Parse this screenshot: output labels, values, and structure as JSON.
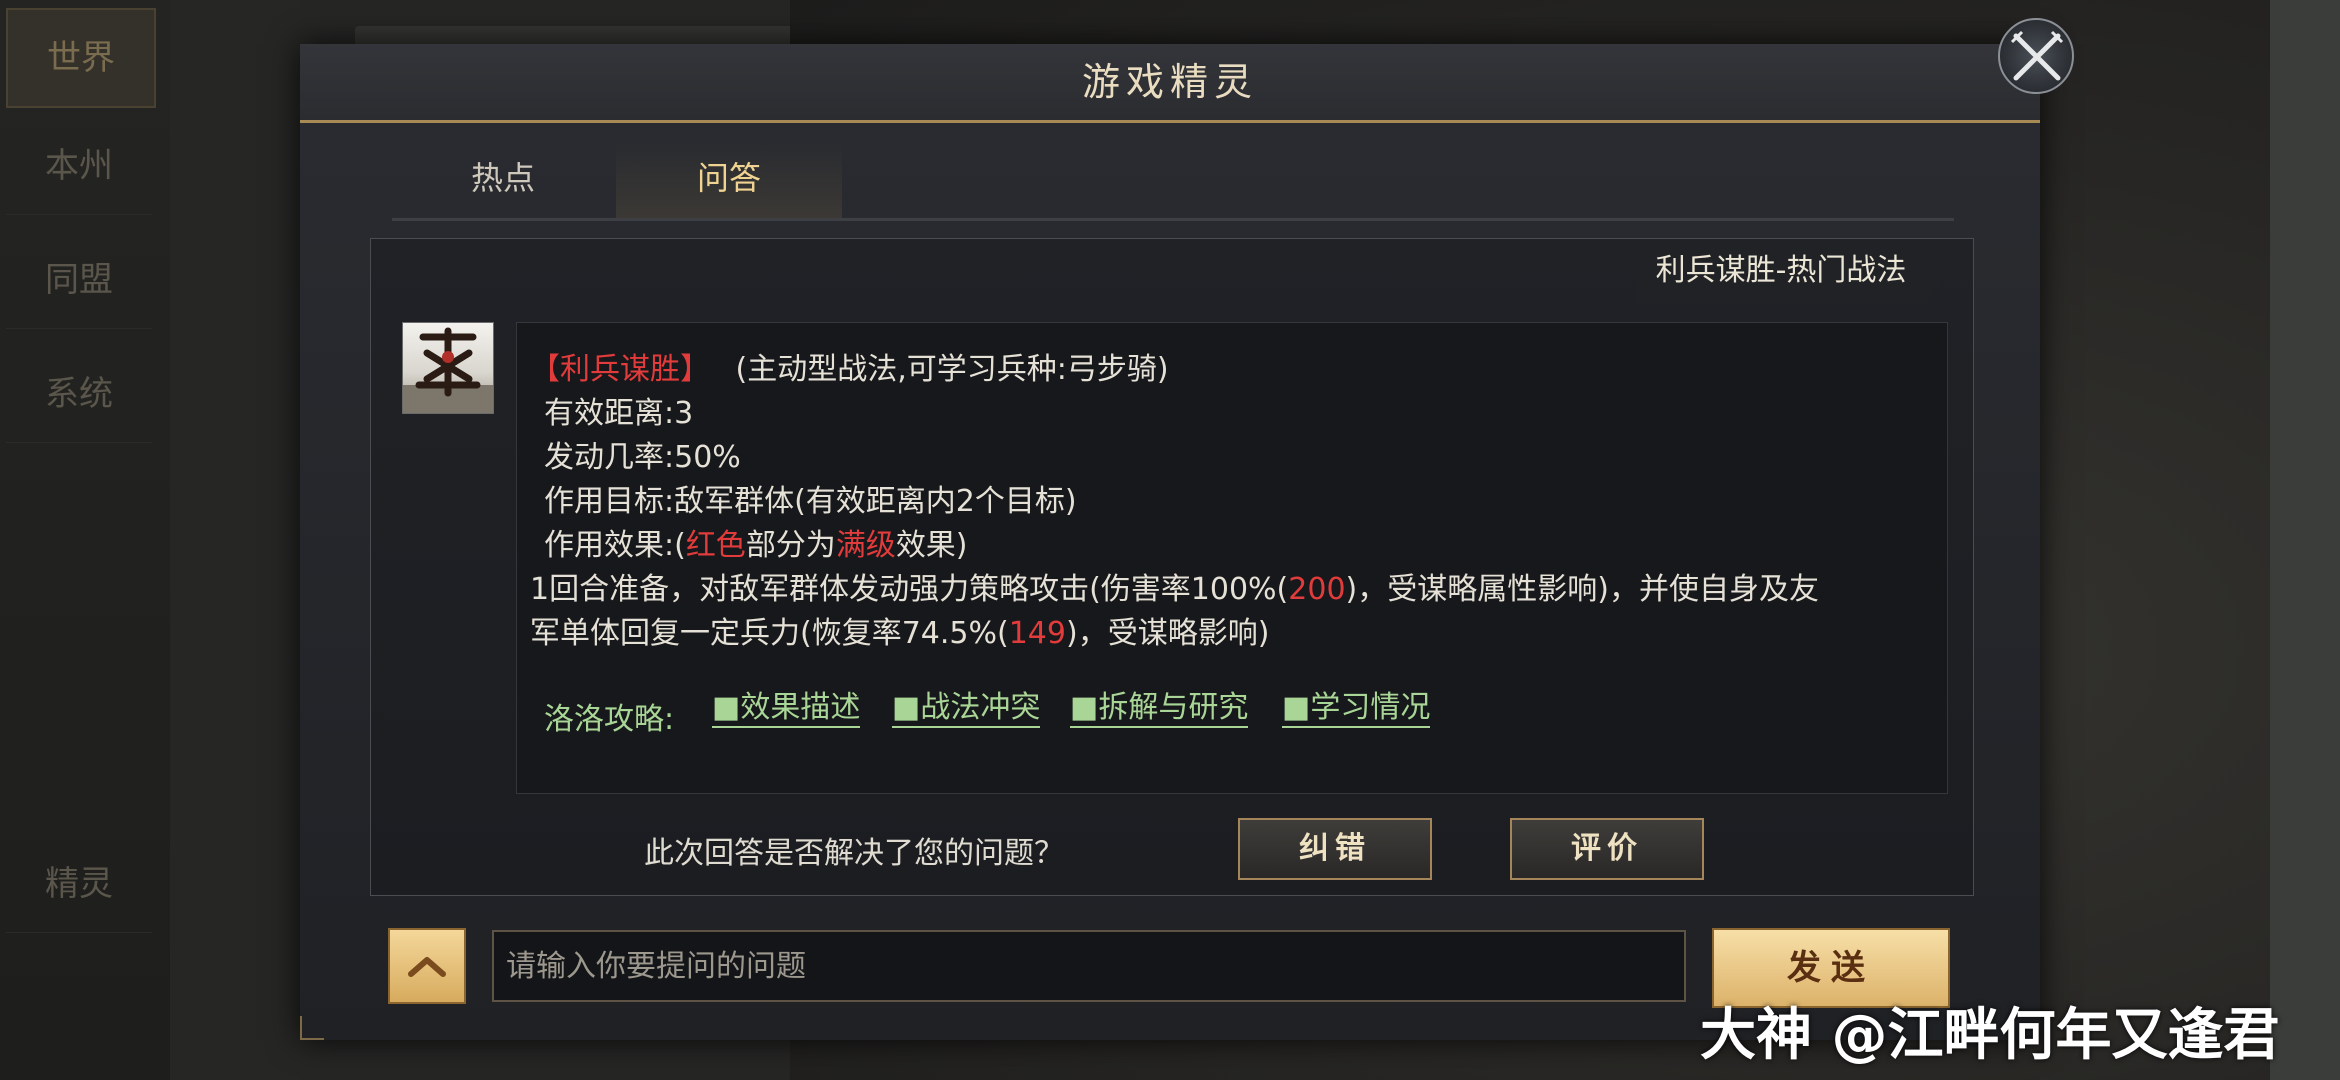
{
  "background": {
    "side_tabs": [
      "世界",
      "本州",
      "同盟",
      "系统"
    ],
    "spirit_tab": "精灵"
  },
  "dialog": {
    "title": "游戏精灵",
    "tabs": [
      {
        "label": "热点",
        "active": false
      },
      {
        "label": "问答",
        "active": true
      }
    ]
  },
  "answer": {
    "tag": "利兵谋胜-热门战法",
    "skill_name": "【利兵谋胜】",
    "skill_type": "(主动型战法,可学习兵种:弓步骑)",
    "range": "有效距离:3",
    "chance": "发动几率:50%",
    "target": "作用目标:敌军群体(有效距离内2个目标)",
    "effect_prefix": "作用效果:(",
    "effect_red1": "红色",
    "effect_mid": "部分为",
    "effect_red2": "满级",
    "effect_suffix": "效果)",
    "desc_line1_a": "1回合准备，对敌军群体发动强力策略攻击(伤害率100%(",
    "desc_line1_val": "200",
    "desc_line1_b": ")，受谋略属性影响)，并使自身及友",
    "desc_line2_a": "军单体回复一定兵力(恢复率74.5%(",
    "desc_line2_val": "149",
    "desc_line2_b": ")，受谋略影响)",
    "guide_label": "洛洛攻略:",
    "guide_links": [
      "■效果描述",
      "■战法冲突",
      "■拆解与研究",
      "■学习情况"
    ]
  },
  "feedback": {
    "question": "此次回答是否解决了您的问题？",
    "correct_label": "纠错",
    "rate_label": "评价"
  },
  "input": {
    "placeholder": "请输入你要提问的问题",
    "send_label": "发送"
  },
  "watermark": "大神 @江畔何年又逢君"
}
